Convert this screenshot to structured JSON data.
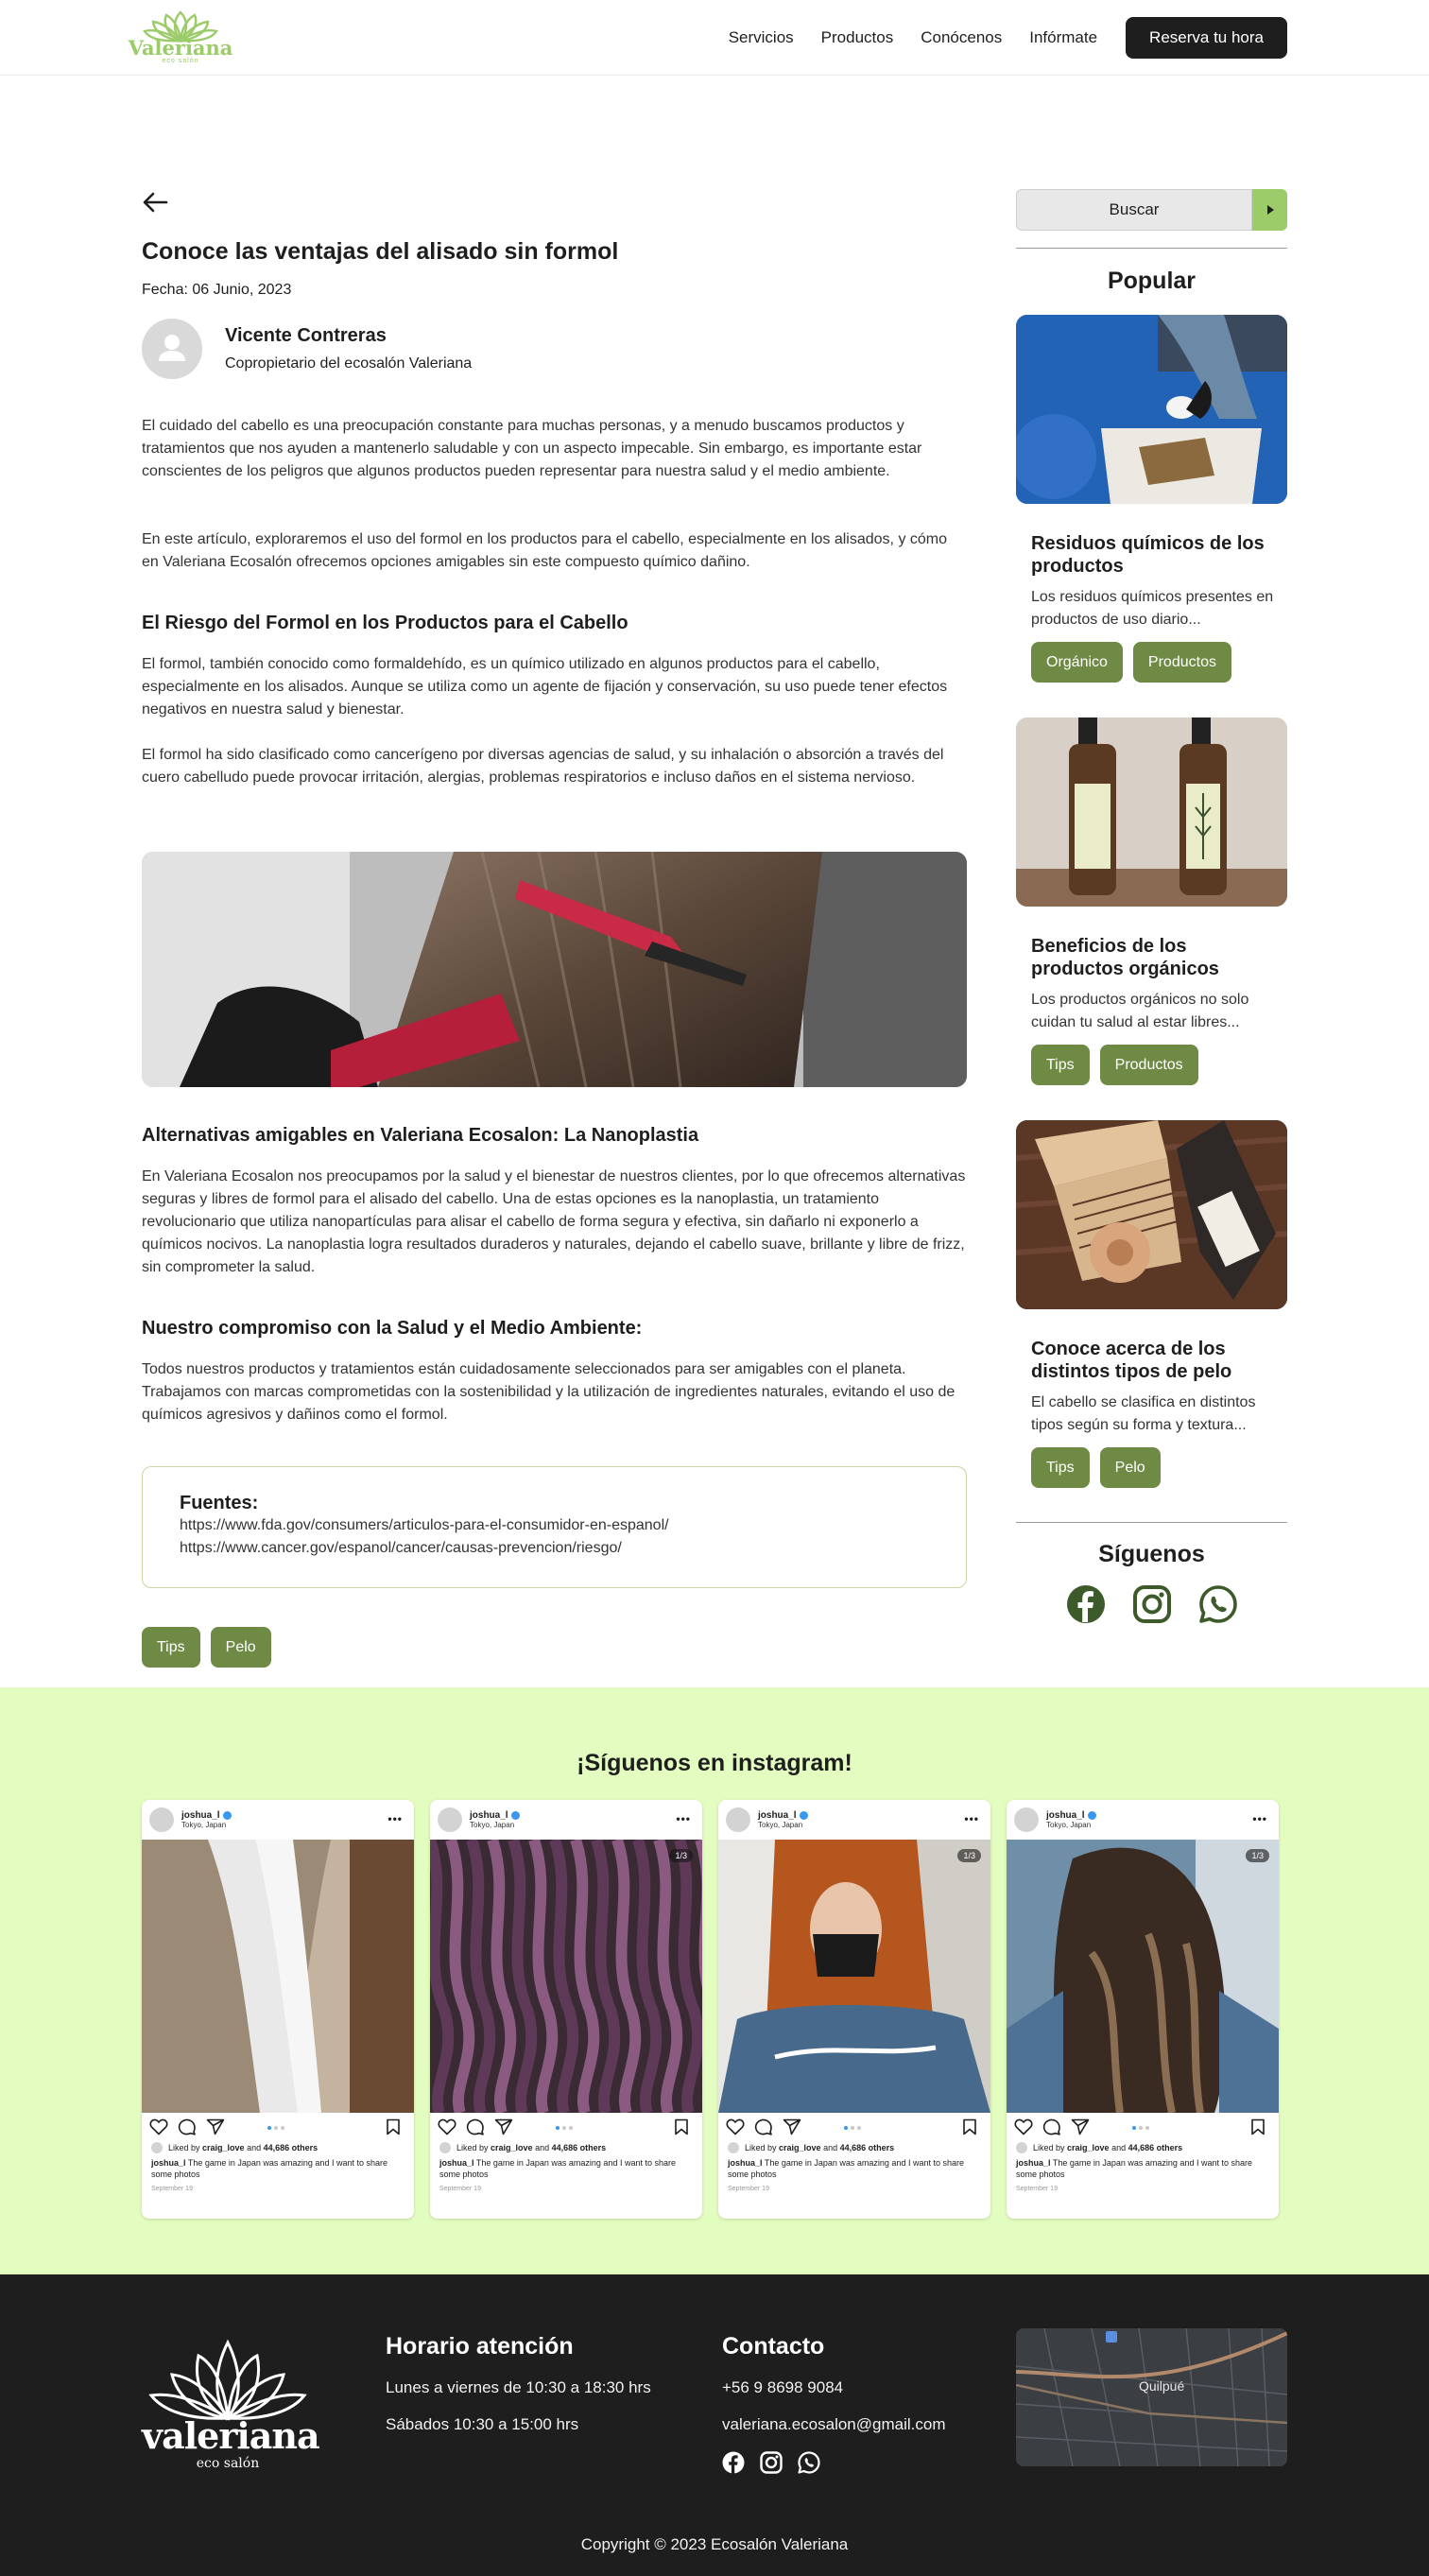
{
  "header": {
    "logo_text": "Valeriana",
    "logo_sub": "eco salón",
    "nav": [
      "Servicios",
      "Productos",
      "Conócenos",
      "Infórmate"
    ],
    "cta": "Reserva tu hora"
  },
  "article": {
    "title": "Conoce las ventajas del alisado sin formol",
    "date": "Fecha: 06 Junio, 2023",
    "author_name": "Vicente Contreras",
    "author_role": "Copropietario del ecosalón Valeriana",
    "intro_1": "El cuidado del cabello es una preocupación constante para muchas personas, y a menudo buscamos productos y tratamientos que nos ayuden a mantenerlo saludable y con un aspecto impecable. Sin  embargo, es importante estar conscientes de los peligros que algunos productos pueden representar para  nuestra salud y el medio ambiente.",
    "intro_2": "En este artículo, exploraremos el uso del formol en los productos para el cabello, especialmente en los alisados, y cómo en Valeriana Ecosalón ofrecemos opciones amigables sin este compuesto químico dañino.",
    "h_riesgo": "El Riesgo del Formol en los Productos para el Cabello",
    "riesgo_1": "El formol, también conocido como formaldehído, es un químico utilizado en algunos productos para el  cabello, especialmente en los alisados. Aunque se utiliza como un agente de fijación y conservación, su uso puede tener efectos negativos en nuestra salud y bienestar.",
    "riesgo_2": "El formol ha sido clasificado como cancerígeno por diversas agencias de salud, y su inhalación o absorción  a través del cuero cabelludo puede provocar irritación, alergias, problemas respiratorios e incluso daños en  el sistema nervioso.",
    "h_alternativas": "Alternativas amigables en Valeriana Ecosalon: La Nanoplastia",
    "alternativas": "En Valeriana Ecosalon nos preocupamos por la salud y el bienestar de nuestros clientes, por lo que  ofrecemos alternativas seguras y libres de formol para el alisado del cabello. Una de estas opciones es la  nanoplastia, un tratamiento revolucionario que utiliza nanopartículas para alisar el cabello de forma segura  y efectiva, sin dañarlo ni exponerlo a químicos nocivos. La nanoplastia logra resultados duraderos y  naturales, dejando el cabello suave, brillante y libre de frizz, sin comprometer la salud.",
    "h_compromiso": "Nuestro compromiso con la Salud y el Medio Ambiente:",
    "compromiso": "Todos nuestros productos y tratamientos están cuidadosamente seleccionados para ser amigables con el planeta. Trabajamos con marcas comprometidas con la sostenibilidad y la utilización de ingredientes  naturales, evitando el uso de químicos agresivos y dañinos como el formol.",
    "fuentes_title": "Fuentes:",
    "fuentes": [
      "https://www.fda.gov/consumers/articulos-para-el-consumidor-en-espanol/",
      "https://www.cancer.gov/espanol/cancer/causas-prevencion/riesgo/"
    ],
    "tags": [
      "Tips",
      "Pelo"
    ]
  },
  "sidebar": {
    "search_label": "Buscar",
    "popular_title": "Popular",
    "cards": [
      {
        "title": "Residuos químicos de los productos",
        "excerpt": "Los residuos químicos presentes en productos de uso diario...",
        "tags": [
          "Orgánico",
          "Productos"
        ]
      },
      {
        "title": "Beneficios de los productos  orgánicos",
        "excerpt": "Los productos orgánicos no solo cuidan tu salud al estar libres...",
        "tags": [
          "Tips",
          "Productos"
        ]
      },
      {
        "title": "Conoce acerca de los distintos tipos de pelo",
        "excerpt": "El cabello se clasifica en distintos tipos según su forma y textura...",
        "tags": [
          "Tips",
          "Pelo"
        ]
      }
    ],
    "follow_title": "Síguenos"
  },
  "instagram": {
    "title": "¡Síguenos en instagram!",
    "posts": [
      {
        "user": "joshua_l",
        "location": "Tokyo, Japan",
        "counter": "",
        "likes_prefix": "Liked by ",
        "likes_user": "craig_love",
        "likes_suffix": " and ",
        "likes_count": "44,686 others",
        "caption_user": "joshua_l",
        "caption": " The game in Japan was amazing and I want to share some photos",
        "date": "September 19"
      },
      {
        "user": "joshua_l",
        "location": "Tokyo, Japan",
        "counter": "1/3",
        "likes_prefix": "Liked by ",
        "likes_user": "craig_love",
        "likes_suffix": " and ",
        "likes_count": "44,686 others",
        "caption_user": "joshua_l",
        "caption": " The game in Japan was amazing and I want to share some photos",
        "date": "September 19"
      },
      {
        "user": "joshua_l",
        "location": "Tokyo, Japan",
        "counter": "1/3",
        "likes_prefix": "Liked by ",
        "likes_user": "craig_love",
        "likes_suffix": " and ",
        "likes_count": "44,686 others",
        "caption_user": "joshua_l",
        "caption": " The game in Japan was amazing and I want to share some photos",
        "date": "September 19"
      },
      {
        "user": "joshua_l",
        "location": "Tokyo, Japan",
        "counter": "1/3",
        "likes_prefix": "Liked by ",
        "likes_user": "craig_love",
        "likes_suffix": " and ",
        "likes_count": "44,686 others",
        "caption_user": "joshua_l",
        "caption": " The game in Japan was amazing and I want to share some photos",
        "date": "September 19"
      }
    ]
  },
  "footer": {
    "logo_text": "valeriana",
    "logo_sub": "eco salón",
    "hours_title": "Horario atención",
    "hours": [
      "Lunes a viernes de 10:30 a 18:30 hrs",
      "Sábados 10:30 a 15:00 hrs"
    ],
    "contact_title": "Contacto",
    "phone": "+56 9 8698 9084",
    "email": "valeriana.ecosalon@gmail.com",
    "map_label": "Quilpué",
    "copyright": "Copyright © 2023 Ecosalón Valeriana"
  },
  "colors": {
    "accent": "#9ccb6a",
    "tag": "#6e8a45",
    "insta_bg": "#e3fcc0",
    "footer_bg": "#1e1e1e"
  }
}
